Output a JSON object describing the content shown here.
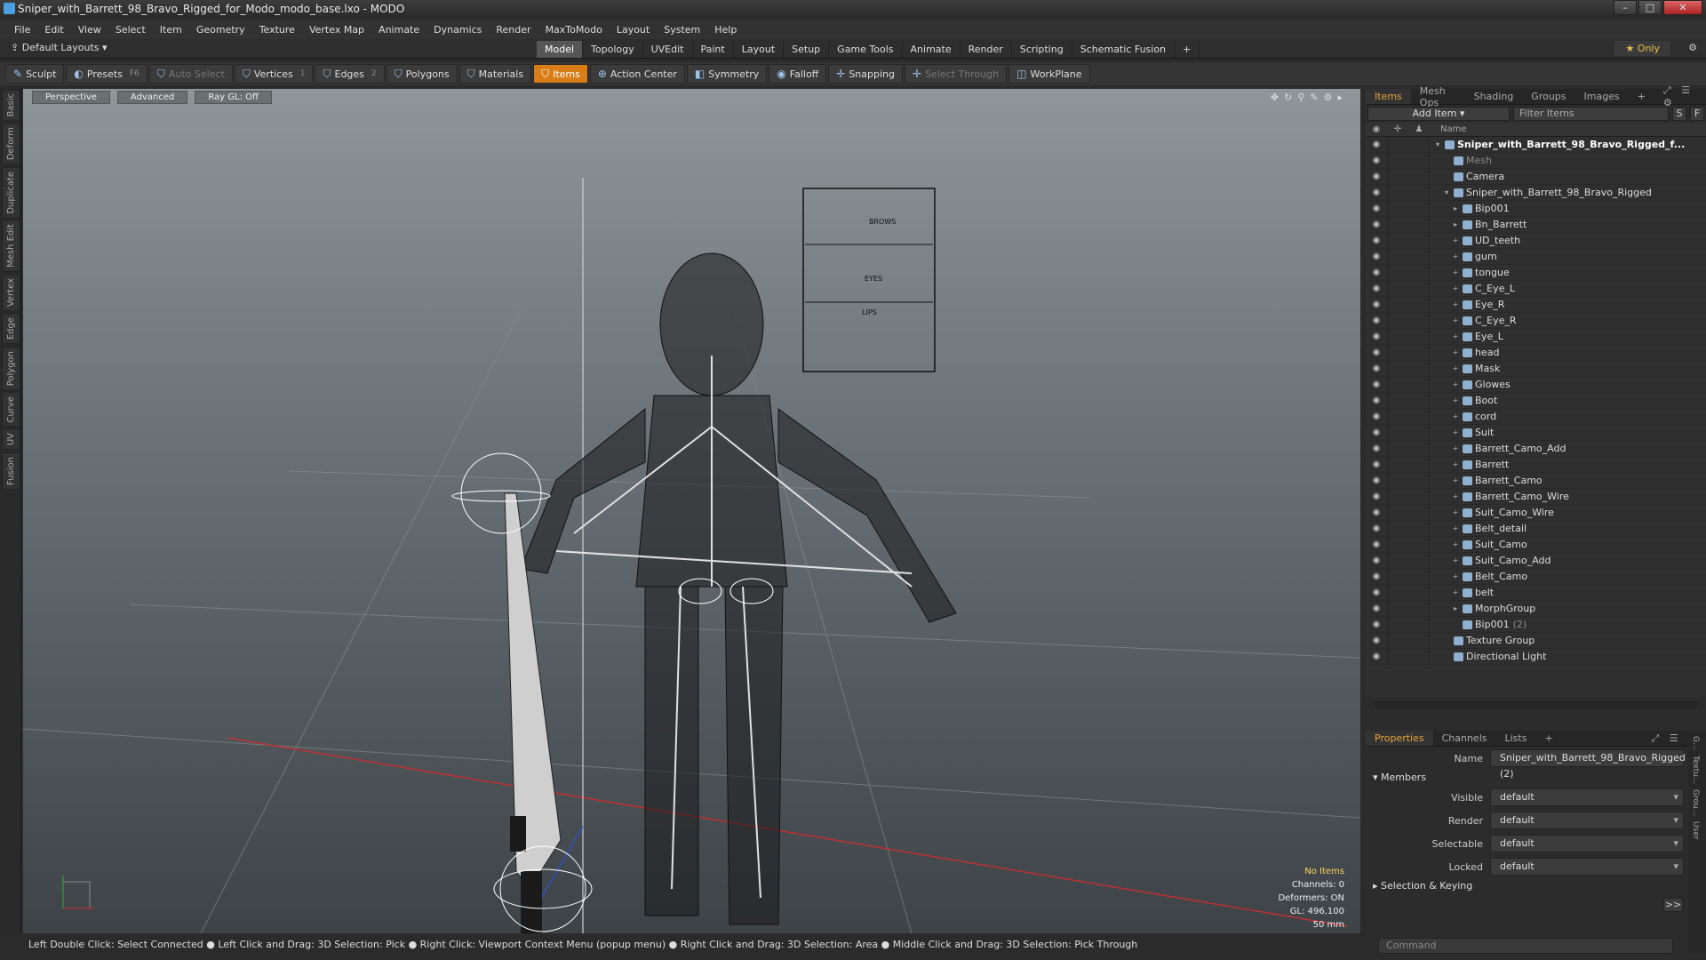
{
  "window": {
    "title": "Sniper_with_Barrett_98_Bravo_Rigged_for_Modo_modo_base.lxo - MODO"
  },
  "menu": [
    "File",
    "Edit",
    "View",
    "Select",
    "Item",
    "Geometry",
    "Texture",
    "Vertex Map",
    "Animate",
    "Dynamics",
    "Render",
    "MaxToModo",
    "Layout",
    "System",
    "Help"
  ],
  "layouts_label": "Default Layouts",
  "mode_tabs": [
    "Model",
    "Topology",
    "UVEdit",
    "Paint",
    "Layout",
    "Setup",
    "Game Tools",
    "Animate",
    "Render",
    "Scripting",
    "Schematic Fusion",
    "+"
  ],
  "only_label": "Only",
  "toolbar": {
    "sculpt": "Sculpt",
    "presets": "Presets",
    "presets_key": "F6",
    "auto_select": "Auto Select",
    "vertices": "Vertices",
    "vertices_n": "1",
    "edges": "Edges",
    "edges_n": "2",
    "polygons": "Polygons",
    "materials": "Materials",
    "items": "Items",
    "action_center": "Action Center",
    "symmetry": "Symmetry",
    "falloff": "Falloff",
    "snapping": "Snapping",
    "select_through": "Select Through",
    "workplane": "WorkPlane"
  },
  "left_tabs": [
    "Basic",
    "Deform",
    "Duplicate",
    "Mesh Edit",
    "Vertex",
    "Edge",
    "Polygon",
    "Curve",
    "UV",
    "Fusion"
  ],
  "viewport": {
    "view": "Perspective",
    "style": "Advanced",
    "raygl": "Ray GL: Off",
    "panel_labels": [
      "BROWS",
      "EYES",
      "LIPS"
    ],
    "info": {
      "no_items": "No Items",
      "channels": "Channels: 0",
      "deformers": "Deformers: ON",
      "gl": "GL: 496,100",
      "lens": "50 mm"
    }
  },
  "statusbar": "Left Double Click: Select Connected ● Left Click and Drag: 3D Selection: Pick ● Right Click: Viewport Context Menu (popup menu) ● Right Click and Drag: 3D Selection: Area ● Middle Click and Drag: 3D Selection: Pick Through",
  "items_panel": {
    "tabs": [
      "Items",
      "Mesh Ops",
      "Shading",
      "Groups",
      "Images",
      "+"
    ],
    "add_item": "Add Item",
    "filter": "Filter Items",
    "s_btn": "S",
    "f_btn": "F",
    "name_col": "Name",
    "tree": [
      {
        "label": "Sniper_with_Barrett_98_Bravo_Rigged_f...",
        "indent": 0,
        "exp": "▾",
        "top": true
      },
      {
        "label": "Mesh",
        "indent": 1,
        "exp": "",
        "dim": true
      },
      {
        "label": "Camera",
        "indent": 1,
        "exp": ""
      },
      {
        "label": "Sniper_with_Barrett_98_Bravo_Rigged",
        "indent": 1,
        "exp": "▾"
      },
      {
        "label": "Bip001",
        "indent": 2,
        "exp": "▸"
      },
      {
        "label": "Bn_Barrett",
        "indent": 2,
        "exp": "▸"
      },
      {
        "label": "UD_teeth",
        "indent": 2,
        "exp": "+"
      },
      {
        "label": "gum",
        "indent": 2,
        "exp": "+"
      },
      {
        "label": "tongue",
        "indent": 2,
        "exp": "+"
      },
      {
        "label": "C_Eye_L",
        "indent": 2,
        "exp": "+"
      },
      {
        "label": "Eye_R",
        "indent": 2,
        "exp": "+"
      },
      {
        "label": "C_Eye_R",
        "indent": 2,
        "exp": "+"
      },
      {
        "label": "Eye_L",
        "indent": 2,
        "exp": "+"
      },
      {
        "label": "head",
        "indent": 2,
        "exp": "+"
      },
      {
        "label": "Mask",
        "indent": 2,
        "exp": "+"
      },
      {
        "label": "Glowes",
        "indent": 2,
        "exp": "+"
      },
      {
        "label": "Boot",
        "indent": 2,
        "exp": "+"
      },
      {
        "label": "cord",
        "indent": 2,
        "exp": "+"
      },
      {
        "label": "Suit",
        "indent": 2,
        "exp": "+"
      },
      {
        "label": "Barrett_Camo_Add",
        "indent": 2,
        "exp": "+"
      },
      {
        "label": "Barrett",
        "indent": 2,
        "exp": "+"
      },
      {
        "label": "Barrett_Camo",
        "indent": 2,
        "exp": "+"
      },
      {
        "label": "Barrett_Camo_Wire",
        "indent": 2,
        "exp": "+"
      },
      {
        "label": "Suit_Camo_Wire",
        "indent": 2,
        "exp": "+"
      },
      {
        "label": "Belt_detail",
        "indent": 2,
        "exp": "+"
      },
      {
        "label": "Suit_Camo",
        "indent": 2,
        "exp": "+"
      },
      {
        "label": "Suit_Camo_Add",
        "indent": 2,
        "exp": "+"
      },
      {
        "label": "Belt_Camo",
        "indent": 2,
        "exp": "+"
      },
      {
        "label": "belt",
        "indent": 2,
        "exp": "+"
      },
      {
        "label": "MorphGroup",
        "indent": 2,
        "exp": "▸"
      },
      {
        "label": "Bip001",
        "indent": 2,
        "exp": "",
        "count": "(2)"
      },
      {
        "label": "Texture Group",
        "indent": 1,
        "exp": ""
      },
      {
        "label": "Directional Light",
        "indent": 1,
        "exp": ""
      }
    ]
  },
  "props_panel": {
    "tabs": [
      "Properties",
      "Channels",
      "Lists",
      "+"
    ],
    "name_label": "Name",
    "name_value": "Sniper_with_Barrett_98_Bravo_Rigged (2)",
    "members": "Members",
    "fields": [
      {
        "label": "Visible",
        "value": "default"
      },
      {
        "label": "Render",
        "value": "default"
      },
      {
        "label": "Selectable",
        "value": "default"
      },
      {
        "label": "Locked",
        "value": "default"
      }
    ],
    "selection_keying": "Selection & Keying",
    "side_tabs": [
      "G...",
      "Textu...",
      "Grou...",
      "User"
    ],
    "more_btn": ">>"
  },
  "command": {
    "placeholder": "Command"
  },
  "colors": {
    "accent": "#d97d18",
    "active_tab": "#e8a33d"
  }
}
